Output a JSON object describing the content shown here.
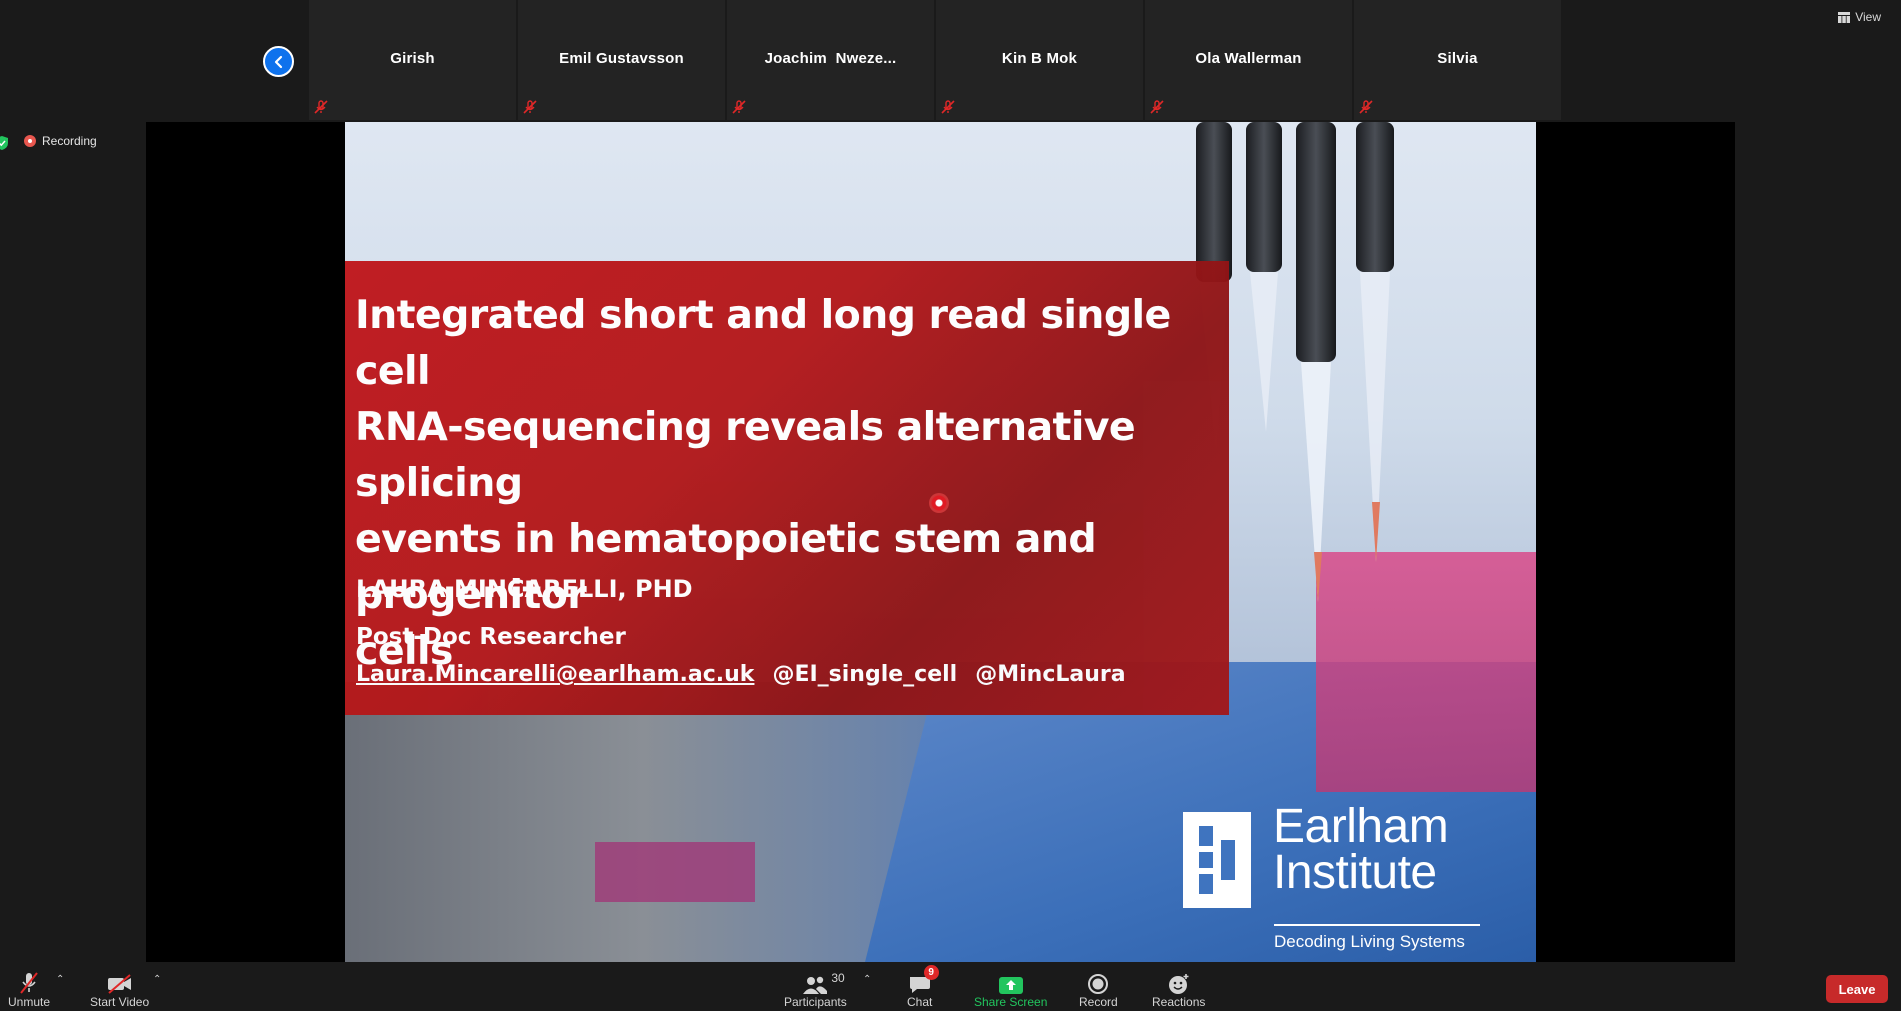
{
  "participants": [
    {
      "name": "Girish"
    },
    {
      "name": "Emil Gustavsson"
    },
    {
      "name": "Joachim  Nweze..."
    },
    {
      "name": "Kin B Mok"
    },
    {
      "name": "Ola Wallerman"
    },
    {
      "name": "Silvia"
    }
  ],
  "top_right": {
    "view_label": "View"
  },
  "recording": {
    "label": "Recording"
  },
  "slide": {
    "title_lines": [
      "Integrated short and long read single cell",
      "RNA-sequencing reveals alternative splicing",
      "events in hematopoietic stem and progenitor",
      "cells"
    ],
    "author": "LAURA MINCARELLI, PHD",
    "role": "Post-Doc Researcher",
    "email": "Laura.Mincarelli@earlham.ac.uk",
    "handle1": "@EI_single_cell",
    "handle2": "@MincLaura",
    "logo": {
      "name_line1": "Earlham",
      "name_line2": "Institute",
      "tagline": "Decoding Living Systems"
    }
  },
  "toolbar": {
    "unmute": "Unmute",
    "start_video": "Start Video",
    "participants_label": "Participants",
    "participants_count": "30",
    "chat_label": "Chat",
    "chat_badge": "9",
    "share_label": "Share Screen",
    "record_label": "Record",
    "reactions_label": "Reactions",
    "leave_label": "Leave"
  },
  "colors": {
    "accent_blue": "#0e72ed",
    "slide_red": "#b3181a",
    "share_green": "#22c55e",
    "leave_red": "#c72a2a",
    "mute_red": "#e02828"
  }
}
